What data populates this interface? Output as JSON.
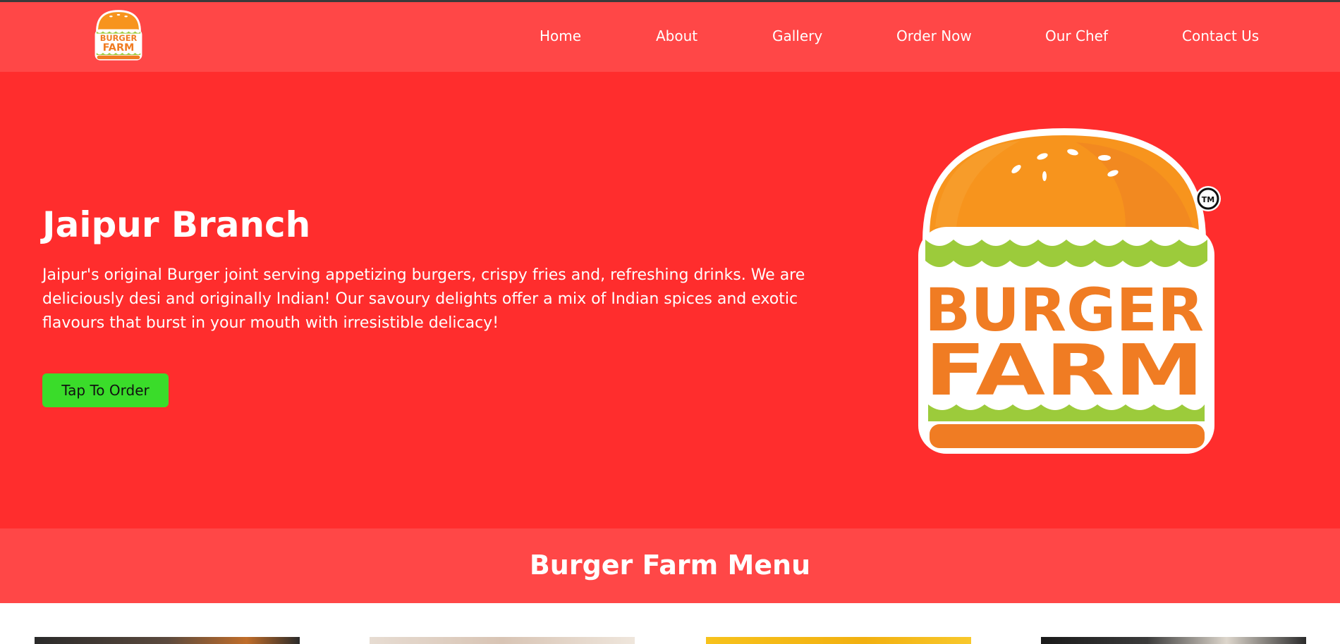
{
  "brand": {
    "logo_text_line1": "BURGER",
    "logo_text_line2": "FARM",
    "trademark": "TM",
    "colors": {
      "bun": "#f7941d",
      "bun_shade": "#ef7f22",
      "lettuce": "#9ccb3b",
      "text_orange": "#f07c23",
      "outline": "#ffffff"
    }
  },
  "nav": {
    "items": [
      {
        "label": "Home"
      },
      {
        "label": "About"
      },
      {
        "label": "Gallery"
      },
      {
        "label": "Order Now"
      },
      {
        "label": "Our Chef"
      },
      {
        "label": "Contact Us"
      }
    ]
  },
  "hero": {
    "title": "Jaipur Branch",
    "description": "Jaipur's original Burger joint serving appetizing burgers, crispy fries and, refreshing drinks. We are deliciously desi and originally Indian! Our savoury delights offer a mix of Indian spices and exotic flavours that burst in your mouth with irresistible delicacy!",
    "cta_label": "Tap To Order"
  },
  "menu": {
    "title": "Burger Farm Menu"
  },
  "theme": {
    "navbar_bg": "#ff4747",
    "hero_bg": "#ff2d2d",
    "cta_bg": "#3adc2a",
    "text": "#ffffff"
  }
}
